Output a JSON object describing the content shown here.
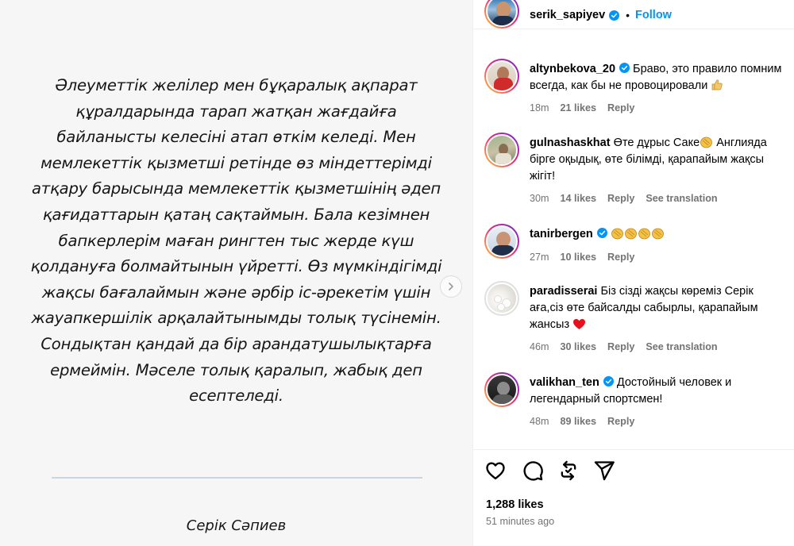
{
  "post": {
    "text": "Әлеуметтік желілер мен бұқаралық ақпарат құралдарында тарап жатқан жағдайға байланысты келесіні атап өткім келеді. Мен мемлекеттік қызметші ретінде өз міндеттерімді атқару барысында мемлекеттік қызметшінің әдеп қағидаттарын қатаң сақтаймын. Бала кезімнен бапкерлерім маған рингтен тыс жерде күш қолдануға болмайтынын үйретті. Өз мүмкіндігімді жақсы бағалаймын және әрбір іс-әрекетім үшін жауапкершілік арқалайтынымды толық түсінемін. Сондықтан қандай да бір арандатушылықтарға ермеймін. Мәселе толық қаралып, жабық деп есептеледі.",
    "signature": "Серік Сәпиев"
  },
  "header": {
    "username": "serik_sapiyev",
    "dot": "•",
    "follow": "Follow"
  },
  "comments": [
    {
      "username": "altynbekova_20",
      "text": "Браво, это правило помним всегда, как бы не провоцировали",
      "time": "18m",
      "likes": "21 likes",
      "reply": "Reply",
      "see_translation": ""
    },
    {
      "username": "gulnashaskhat",
      "text_before": "Өте дұрыс Саке",
      "text_after": " Англияда бірге оқыдық, өте білімді, қарапайым жақсы жігіт!",
      "time": "30m",
      "likes": "14 likes",
      "reply": "Reply",
      "see_translation": "See translation"
    },
    {
      "username": "tanirbergen",
      "text": "",
      "time": "27m",
      "likes": "10 likes",
      "reply": "Reply"
    },
    {
      "username": "paradisserai",
      "text": "Біз сізді жақсы көреміз Серік аға,сіз өте байсалды сабырлы, қарапайым жансыз",
      "time": "46m",
      "likes": "30 likes",
      "reply": "Reply",
      "see_translation": "See translation"
    },
    {
      "username": "valikhan_ten",
      "text": "Достойный человек и легендарный спортсмен!",
      "time": "48m",
      "likes": "89 likes",
      "reply": "Reply"
    }
  ],
  "footer": {
    "likes": "1,288 likes",
    "time_ago": "51 minutes ago"
  },
  "colors": {
    "accent": "#0095f6",
    "muted": "#737373",
    "heart": "#e8101c"
  }
}
